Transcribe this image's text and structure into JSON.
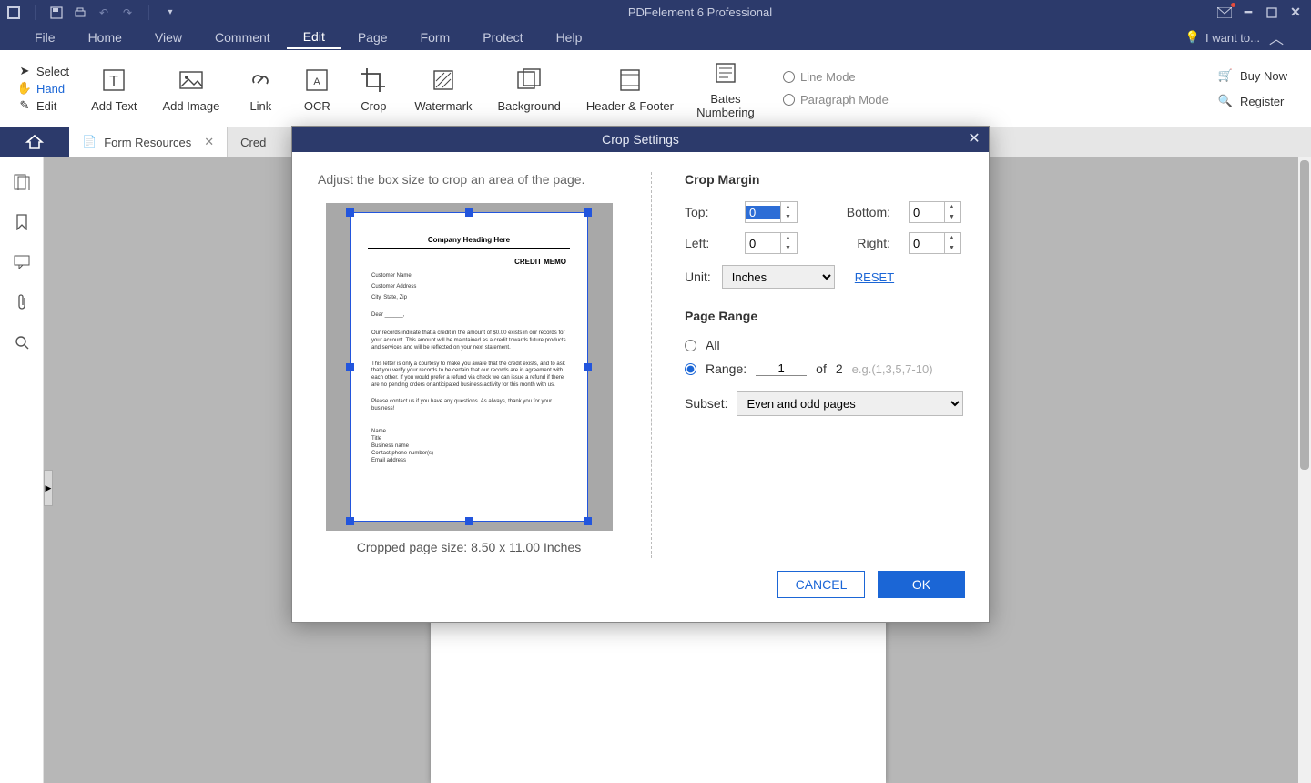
{
  "app": {
    "title": "PDFelement 6 Professional"
  },
  "menubar": {
    "items": [
      "File",
      "Home",
      "View",
      "Comment",
      "Edit",
      "Page",
      "Form",
      "Protect",
      "Help"
    ],
    "active": "Edit",
    "i_want_to": "I want to..."
  },
  "ribbon": {
    "vTools": {
      "select": "Select",
      "hand": "Hand",
      "edit": "Edit"
    },
    "bigTools": {
      "add_text": "Add Text",
      "add_image": "Add Image",
      "link": "Link",
      "ocr": "OCR",
      "crop": "Crop",
      "watermark": "Watermark",
      "background": "Background",
      "header_footer": "Header & Footer",
      "bates": "Bates Numbering"
    },
    "modes": {
      "line": "Line Mode",
      "paragraph": "Paragraph Mode"
    },
    "right": {
      "buy": "Buy Now",
      "register": "Register"
    }
  },
  "tabs": {
    "tab1": "Form Resources",
    "tab2": "Cred"
  },
  "dialog": {
    "title": "Crop Settings",
    "hint": "Adjust the box size to crop an area of the page.",
    "preview": {
      "heading": "Company Heading Here",
      "memo": "CREDIT MEMO",
      "addr1": "Customer Name",
      "addr2": "Customer Address",
      "addr3": "City, State, Zip",
      "dear": "Dear ______,",
      "p1": "Our records indicate that a credit in the amount of $0.00 exists in our records for your account. This amount will be maintained as a credit towards future products and services and will be reflected on your next statement.",
      "p2": "This letter is only a courtesy to make you aware that the credit exists, and to ask that you verify your records to be certain that our records are in agreement with each other. If you would prefer a refund via check we can issue a refund if there are no pending orders or anticipated business activity for this month with us.",
      "p3": "Please contact us if you have any questions. As always, thank you for your business!",
      "sig": "Name\nTitle\nBusiness name\nContact phone number(s)\nEmail address"
    },
    "page_size": "Cropped page size: 8.50 x 11.00 Inches",
    "section_margin": "Crop Margin",
    "labels": {
      "top": "Top:",
      "bottom": "Bottom:",
      "left": "Left:",
      "right": "Right:",
      "unit": "Unit:",
      "reset": "RESET",
      "subset": "Subset:",
      "range": "Range:",
      "all": "All",
      "of": "of"
    },
    "values": {
      "top": "0",
      "bottom": "0",
      "left": "0",
      "right": "0",
      "unit": "Inches",
      "range_from": "1",
      "range_to": "2",
      "subset": "Even and odd pages"
    },
    "hint_eg": "e.g.(1,3,5,7-10)",
    "section_range": "Page Range",
    "buttons": {
      "cancel": "CANCEL",
      "ok": "OK"
    }
  }
}
